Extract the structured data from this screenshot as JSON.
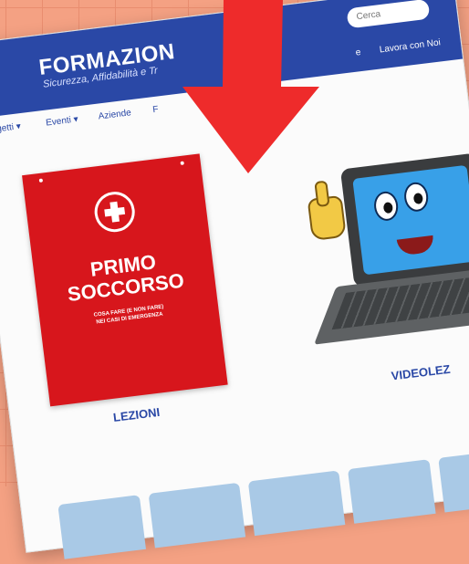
{
  "header": {
    "logo": "FORMAZION",
    "tagline": "Sicurezza, Affidabilità e Tr",
    "search_placeholder": "Cerca",
    "util_links": [
      "e",
      "Lavora con Noi"
    ]
  },
  "nav": {
    "items": [
      "Progetti ▾",
      "Eventi ▾",
      "Aziende",
      "F"
    ]
  },
  "poster": {
    "title_line1": "PRIMO",
    "title_line2": "SOCCORSO",
    "subtitle_line1": "COSA FARE (E NON FARE)",
    "subtitle_line2": "NEI CASI DI EMERGENZA"
  },
  "labels": {
    "lezioni": "LEZIONI",
    "videolezioni": "VIDEOLEZ"
  },
  "colors": {
    "background": "#f4a183",
    "header_blue": "#2a48a6",
    "poster_red": "#d7161c",
    "arrow_red": "#ee2b2b",
    "strip_blue": "#a9c9e6"
  },
  "icons": [
    "first-aid-cross-icon",
    "down-arrow-icon",
    "laptop-mascot-icon"
  ]
}
